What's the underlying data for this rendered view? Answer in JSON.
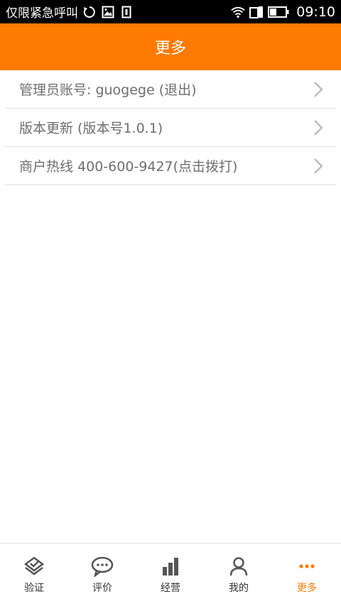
{
  "status_bar": {
    "carrier_text": "仅限紧急呼叫",
    "time": "09:10",
    "icons_left": [
      "sync-icon",
      "image-icon",
      "sim-icon"
    ],
    "icons_right": [
      "wifi-icon",
      "signal-icon",
      "battery-icon"
    ]
  },
  "header": {
    "title": "更多",
    "background": "#ff7a00"
  },
  "menu": {
    "items": [
      {
        "label": "管理员账号: guogege  (退出)"
      },
      {
        "label": "版本更新  (版本号1.0.1)"
      },
      {
        "label": "商户热线  400-600-9427(点击拨打)"
      }
    ]
  },
  "tabs": [
    {
      "label": "验证",
      "icon": "verify-icon",
      "active": false
    },
    {
      "label": "评价",
      "icon": "comment-icon",
      "active": false
    },
    {
      "label": "经营",
      "icon": "bar-chart-icon",
      "active": false
    },
    {
      "label": "我的",
      "icon": "user-icon",
      "active": false
    },
    {
      "label": "更多",
      "icon": "more-dots-icon",
      "active": true
    }
  ],
  "colors": {
    "accent": "#ff7a00",
    "text_muted": "#6e6e6e",
    "divider": "#dedede"
  }
}
